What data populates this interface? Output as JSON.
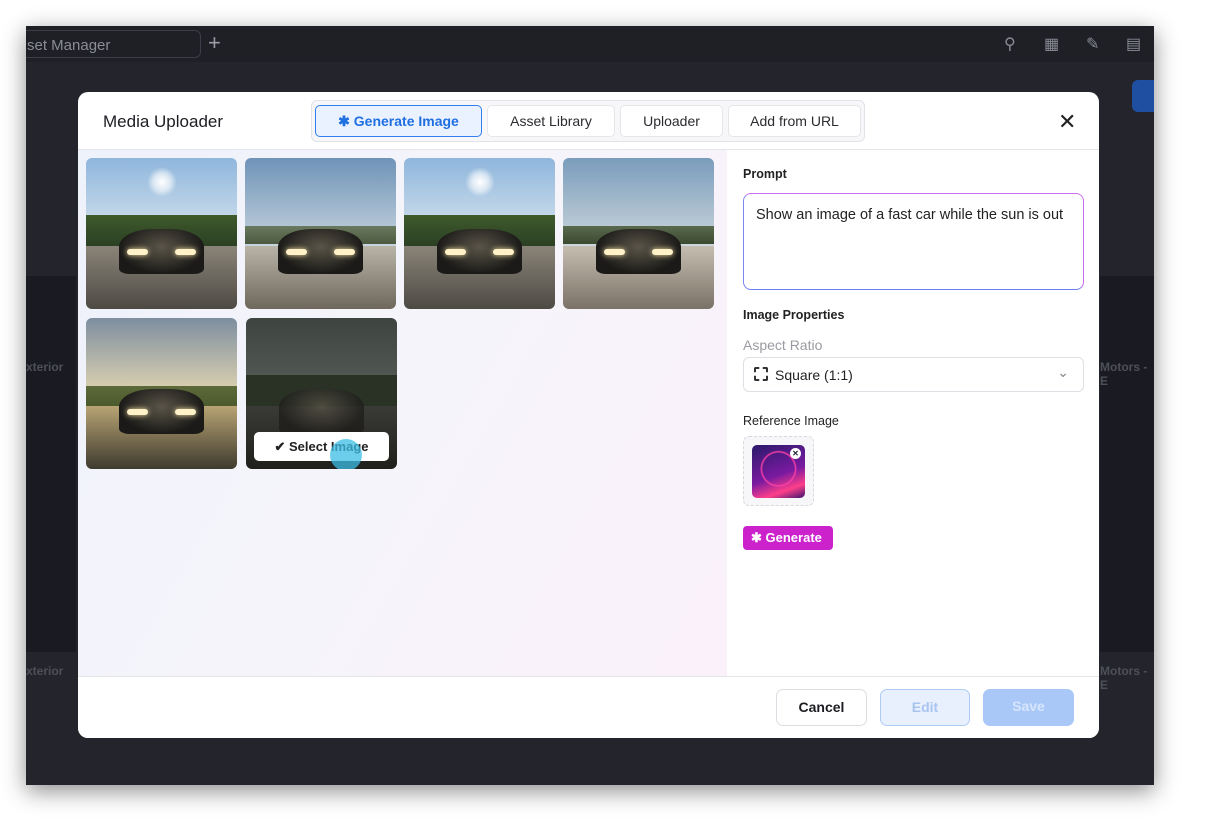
{
  "background_app": {
    "tab_title": "set Manager",
    "card_titles": [
      "xterior",
      "xterior",
      "Motors - E",
      "Motors - E"
    ]
  },
  "modal": {
    "title": "Media Uploader",
    "tabs": [
      {
        "label": "Generate Image",
        "active": true
      },
      {
        "label": "Asset Library",
        "active": false
      },
      {
        "label": "Uploader",
        "active": false
      },
      {
        "label": "Add from URL",
        "active": false
      }
    ],
    "close_icon": "close-icon",
    "generated_images": [
      {
        "variant": "sun-trees"
      },
      {
        "variant": "hills-shadow"
      },
      {
        "variant": "sun-trees"
      },
      {
        "variant": "hills-shadow"
      },
      {
        "variant": "sunset-field"
      },
      {
        "variant": "dark-hover"
      }
    ],
    "select_image_label": "Select Image",
    "prompt_label": "Prompt",
    "prompt_value": "Show an image of a fast car while the sun is out",
    "image_properties_label": "Image Properties",
    "aspect_ratio_label": "Aspect Ratio",
    "aspect_ratio_value": "Square (1:1)",
    "reference_image_label": "Reference Image",
    "generate_label": "Generate",
    "cancel_label": "Cancel",
    "edit_label": "Edit",
    "save_label": "Save"
  },
  "colors": {
    "accent": "#2f7ff0",
    "generate": "#cc22cc"
  }
}
